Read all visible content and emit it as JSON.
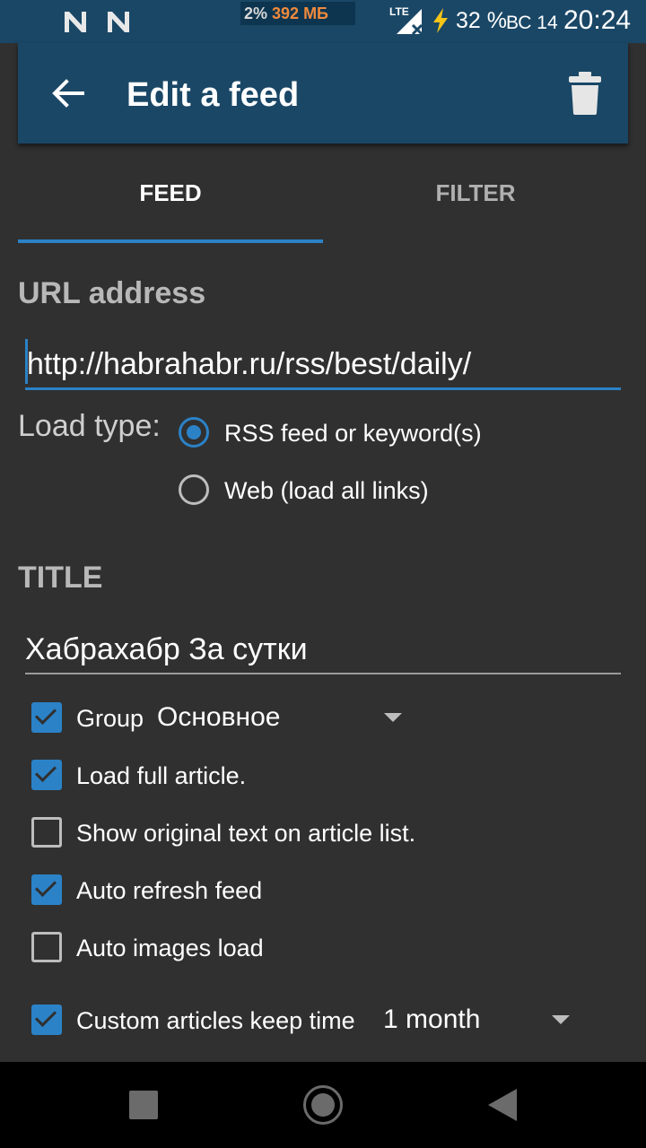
{
  "status_bar": {
    "memory_percent": "2%",
    "memory_size": "392 МБ",
    "network": "LTE",
    "battery": "32 %",
    "day": "ВС 14",
    "time": "20:24",
    "icons": [
      "n-icon",
      "n-icon",
      "signal-icon",
      "charging-icon"
    ]
  },
  "app_bar": {
    "title": "Edit a feed",
    "back_icon": "arrow-back-icon",
    "delete_icon": "trash-icon",
    "color": "#1a4766"
  },
  "tabs": [
    {
      "label": "FEED",
      "selected": true
    },
    {
      "label": "FILTER",
      "selected": false
    }
  ],
  "url_section": {
    "heading": "URL address",
    "value": "http://habrahabr.ru/rss/best/daily/"
  },
  "load_type": {
    "label": "Load type:",
    "options": [
      {
        "label": "RSS feed or keyword(s)",
        "selected": true
      },
      {
        "label": "Web (load all links)",
        "selected": false
      }
    ]
  },
  "title_section": {
    "heading": "TITLE",
    "value": "Хабрахабр За сутки"
  },
  "options": {
    "group": {
      "label": "Group",
      "value": "Основное",
      "checked": true
    },
    "load_full_article": {
      "label": "Load full article.",
      "checked": true
    },
    "show_original_text": {
      "label": "Show original text on article list.",
      "checked": false
    },
    "auto_refresh": {
      "label": "Auto refresh feed",
      "checked": true
    },
    "auto_images": {
      "label": "Auto images load",
      "checked": false
    },
    "keep_time": {
      "label": "Custom articles keep time",
      "value": "1 month",
      "checked": true
    }
  },
  "colors": {
    "accent": "#2b82c7",
    "background": "#303030"
  },
  "nav_bar": {
    "icons": [
      "recents-icon",
      "home-icon",
      "back-icon"
    ]
  }
}
